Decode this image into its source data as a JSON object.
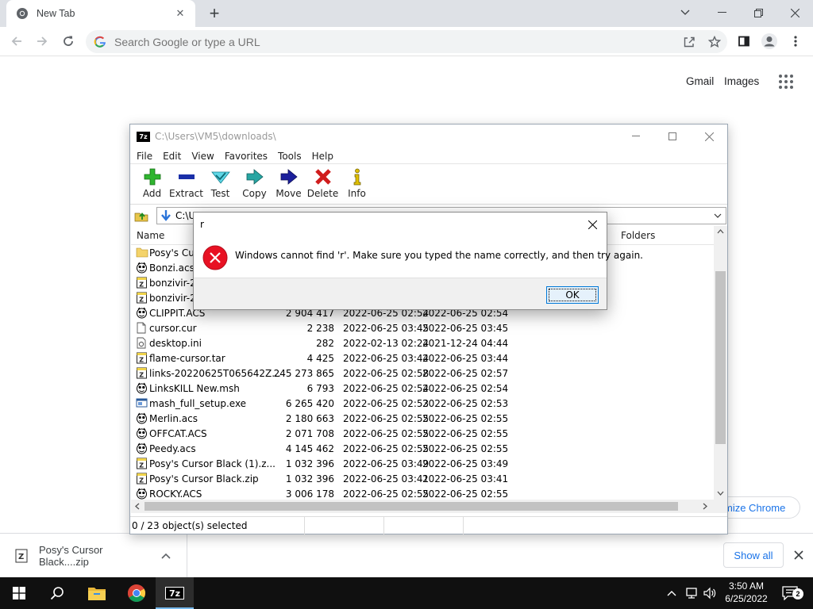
{
  "chrome": {
    "tab_title": "New Tab",
    "omnibox_placeholder": "Search Google or type a URL",
    "links": {
      "gmail": "Gmail",
      "images": "Images"
    },
    "customize": "mize Chrome",
    "download": {
      "filename": "Posy's Cursor Black....zip",
      "show_all": "Show all"
    }
  },
  "zip": {
    "title": "C:\\Users\\VM5\\downloads\\",
    "menu": [
      "File",
      "Edit",
      "View",
      "Favorites",
      "Tools",
      "Help"
    ],
    "tools": [
      {
        "label": "Add",
        "icon": "add-icon",
        "color": "#2fb52f"
      },
      {
        "label": "Extract",
        "icon": "extract-icon",
        "color": "#1a2fa8"
      },
      {
        "label": "Test",
        "icon": "test-icon",
        "color": "#19b6c9"
      },
      {
        "label": "Copy",
        "icon": "copy-icon",
        "color": "#17908e"
      },
      {
        "label": "Move",
        "icon": "move-icon",
        "color": "#1b1f9c"
      },
      {
        "label": "Delete",
        "icon": "delete-icon",
        "color": "#d01d1d"
      },
      {
        "label": "Info",
        "icon": "info-icon",
        "color": "#c8a800"
      }
    ],
    "path": "C:\\U",
    "columns": {
      "name": "Name",
      "folders": "Folders"
    },
    "files": [
      {
        "icon": "folder-icon",
        "name": "Posy's Cur",
        "size": "",
        "modified": "",
        "created": ""
      },
      {
        "icon": "agent-icon",
        "name": "Bonzi.acs",
        "size": "",
        "modified": "",
        "created": ""
      },
      {
        "icon": "archive-icon",
        "name": "bonzivir-20",
        "size": "",
        "modified": "",
        "created": ""
      },
      {
        "icon": "archive-icon",
        "name": "bonzivir-20",
        "size": "",
        "modified": "",
        "created": ""
      },
      {
        "icon": "agent-icon",
        "name": "CLIPPIT.ACS",
        "size": "2 904 417",
        "modified": "2022-06-25 02:54",
        "created": "2022-06-25 02:54"
      },
      {
        "icon": "file-icon",
        "name": "cursor.cur",
        "size": "2 238",
        "modified": "2022-06-25 03:45",
        "created": "2022-06-25 03:45"
      },
      {
        "icon": "settings-file-icon",
        "name": "desktop.ini",
        "size": "282",
        "modified": "2022-02-13 02:24",
        "created": "2021-12-24 04:44"
      },
      {
        "icon": "archive-icon",
        "name": "flame-cursor.tar",
        "size": "4 425",
        "modified": "2022-06-25 03:44",
        "created": "2022-06-25 03:44"
      },
      {
        "icon": "archive-icon",
        "name": "links-20220625T065642Z...",
        "size": "245 273 865",
        "modified": "2022-06-25 02:58",
        "created": "2022-06-25 02:57"
      },
      {
        "icon": "agent-icon",
        "name": "LinksKILL New.msh",
        "size": "6 793",
        "modified": "2022-06-25 02:54",
        "created": "2022-06-25 02:54"
      },
      {
        "icon": "exe-icon",
        "name": "mash_full_setup.exe",
        "size": "6 265 420",
        "modified": "2022-06-25 02:53",
        "created": "2022-06-25 02:53"
      },
      {
        "icon": "agent-icon",
        "name": "Merlin.acs",
        "size": "2 180 663",
        "modified": "2022-06-25 02:55",
        "created": "2022-06-25 02:55"
      },
      {
        "icon": "agent-icon",
        "name": "OFFCAT.ACS",
        "size": "2 071 708",
        "modified": "2022-06-25 02:55",
        "created": "2022-06-25 02:55"
      },
      {
        "icon": "agent-icon",
        "name": "Peedy.acs",
        "size": "4 145 462",
        "modified": "2022-06-25 02:55",
        "created": "2022-06-25 02:55"
      },
      {
        "icon": "archive-icon",
        "name": "Posy's Cursor Black (1).z...",
        "size": "1 032 396",
        "modified": "2022-06-25 03:49",
        "created": "2022-06-25 03:49"
      },
      {
        "icon": "archive-icon",
        "name": "Posy's Cursor Black.zip",
        "size": "1 032 396",
        "modified": "2022-06-25 03:41",
        "created": "2022-06-25 03:41"
      },
      {
        "icon": "agent-icon",
        "name": "ROCKY.ACS",
        "size": "3 006 178",
        "modified": "2022-06-25 02:55",
        "created": "2022-06-25 02:55"
      }
    ],
    "status": "0 / 23 object(s) selected"
  },
  "dialog": {
    "title": "r",
    "message": "Windows cannot find 'r'. Make sure you typed the name correctly, and then try again.",
    "ok": "OK"
  },
  "taskbar": {
    "time": "3:50 AM",
    "date": "6/25/2022",
    "notifications": "2"
  }
}
